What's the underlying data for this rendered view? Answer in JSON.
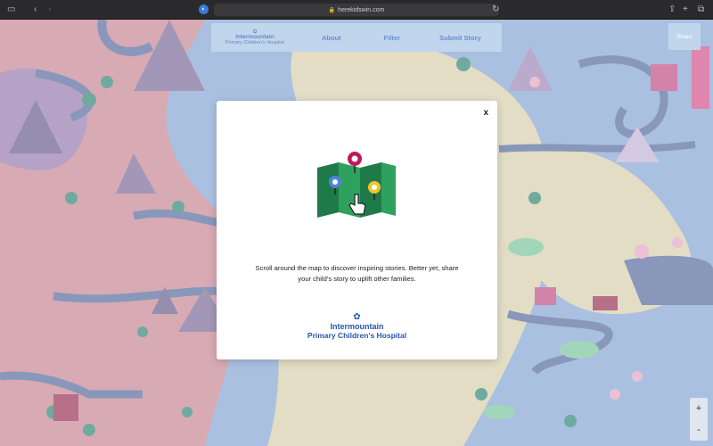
{
  "browser": {
    "url": "herekidswin.com",
    "icons": [
      "sidebar-icon",
      "back-icon",
      "forward-icon",
      "reload-icon",
      "share-icon",
      "new-tab-icon",
      "tabs-icon"
    ]
  },
  "nav": {
    "logo_line1": "Intermountain",
    "logo_line2": "Primary Children's Hospital",
    "about": "About",
    "filter": "Filter",
    "submit": "Submit Story",
    "share": "Share"
  },
  "modal": {
    "close": "x",
    "message": "Scroll around the map to discover inspiring stories. Better yet, share your child’s story to uplift other families.",
    "brand_line1": "Intermountain",
    "brand_line2": "Primary Children’s Hospital"
  },
  "zoom": {
    "in": "+",
    "out": "-"
  },
  "colors": {
    "map_pink": "#c98a96",
    "map_sand": "#d8d0b0",
    "map_blue": "#8aa8d4",
    "road": "#5a6fa0",
    "brand_blue": "#2557a8",
    "pin_magenta": "#c2185b",
    "pin_yellow": "#f2c230",
    "pin_blue": "#4a86d6"
  }
}
